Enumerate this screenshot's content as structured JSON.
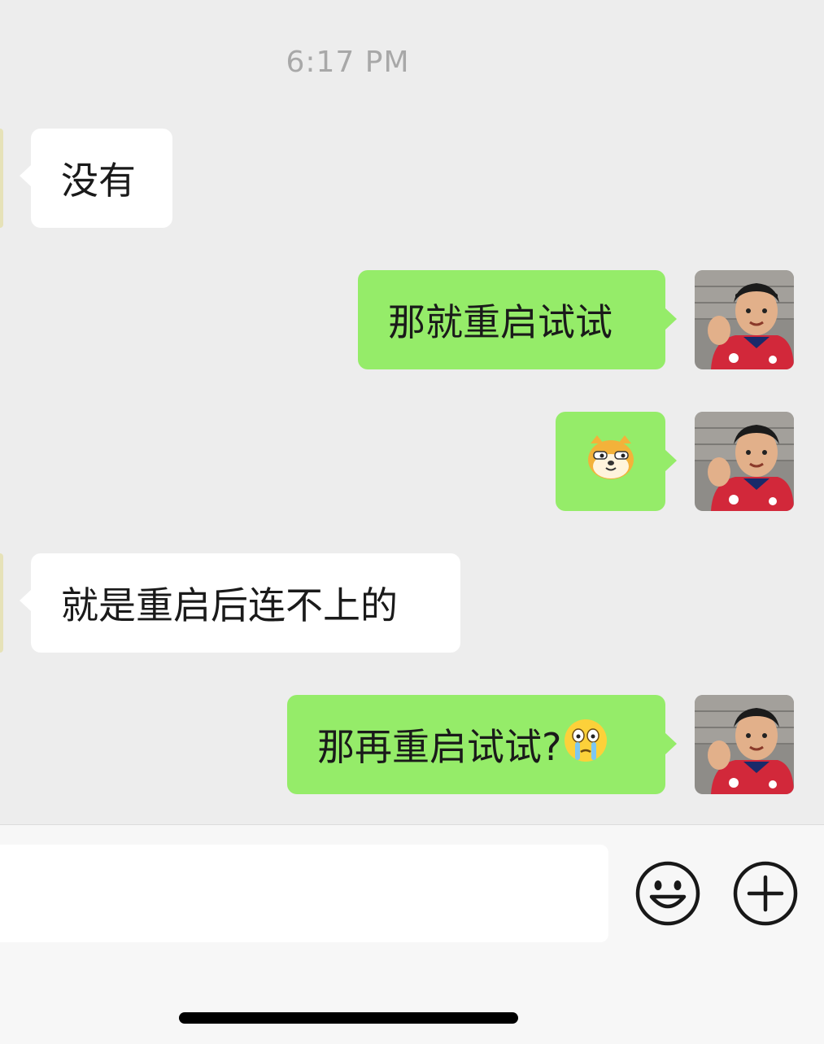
{
  "chat": {
    "timestamp": "6:17 PM",
    "messages": [
      {
        "direction": "incoming",
        "text": "没有"
      },
      {
        "direction": "outgoing",
        "text": "那就重启试试"
      },
      {
        "direction": "outgoing",
        "text": "",
        "sticker": "doge-cat-emoji"
      },
      {
        "direction": "incoming",
        "text": "就是重启后连不上的"
      },
      {
        "direction": "outgoing",
        "text": "那再重启试试?",
        "trailing_emoji": "crying-face-emoji"
      }
    ]
  },
  "input_bar": {
    "text_value": "",
    "emoji_button_icon": "smiley-face-icon",
    "more_button_icon": "plus-circle-icon"
  },
  "colors": {
    "background": "#ededed",
    "outgoing_bubble": "#95ec69",
    "incoming_bubble": "#ffffff",
    "timestamp_text": "#a8a8a8"
  }
}
